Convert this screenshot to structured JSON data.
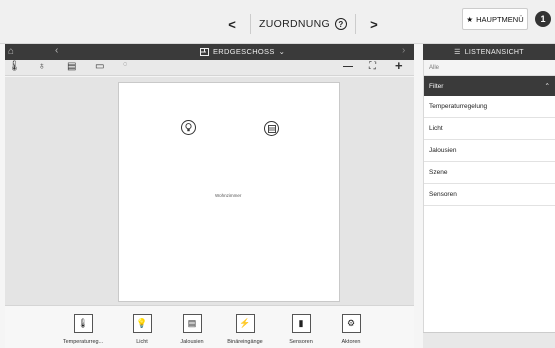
{
  "header": {
    "title": "ZUORDNUNG",
    "help_glyph": "?",
    "prev_glyph": "<",
    "next_glyph": ">",
    "main_menu_label": "HAUPTMENÜ",
    "notification_count": "1"
  },
  "floor": {
    "title": "ERDGESCHOSS",
    "room_label": "Wohnzimmer"
  },
  "devices": [
    {
      "label": "Temperaturreg...",
      "icon": "thermostat-icon"
    },
    {
      "label": "Licht",
      "icon": "bulb-icon"
    },
    {
      "label": "Jalousien",
      "icon": "blinds-icon"
    },
    {
      "label": "Binäreingänge",
      "icon": "binary-input-icon"
    },
    {
      "label": "Sensoren",
      "icon": "sensor-icon"
    },
    {
      "label": "Aktoren",
      "icon": "actuator-icon"
    }
  ],
  "list_panel": {
    "title": "LISTENANSICHT",
    "all_label": "Alle",
    "filter_label": "Filter",
    "items": [
      "Temperaturregelung",
      "Licht",
      "Jalousien",
      "Szene",
      "Sensoren"
    ]
  },
  "colors": {
    "dark_header": "#3a3a3a",
    "canvas": "#e4e4e4"
  }
}
